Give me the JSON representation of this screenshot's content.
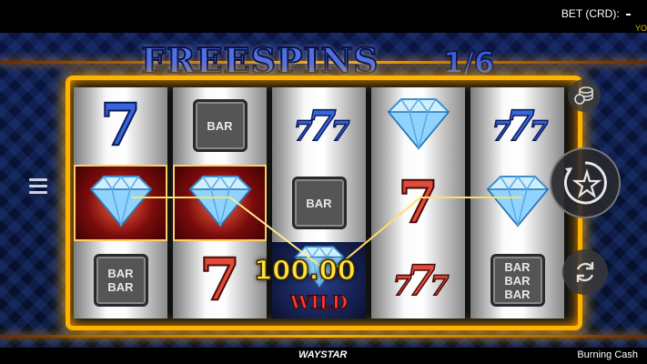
{
  "header": {
    "bet_label": "BET (CRD):",
    "bet_value": "",
    "your_label": "YO"
  },
  "banner": {
    "title": "FREESPINS",
    "counter": "1/6"
  },
  "reels": [
    [
      {
        "sym": "seven-blue"
      },
      {
        "sym": "diamond",
        "highlight": true
      },
      {
        "sym": "bar-double",
        "lines": [
          "BAR",
          "BAR"
        ]
      }
    ],
    [
      {
        "sym": "bar-single",
        "lines": [
          "BAR"
        ]
      },
      {
        "sym": "diamond",
        "highlight": true
      },
      {
        "sym": "seven-red"
      }
    ],
    [
      {
        "sym": "triple-seven-blue"
      },
      {
        "sym": "bar-single",
        "lines": [
          "BAR"
        ]
      },
      {
        "sym": "wild",
        "label": "WILD"
      }
    ],
    [
      {
        "sym": "diamond"
      },
      {
        "sym": "seven-red"
      },
      {
        "sym": "triple-seven-red"
      }
    ],
    [
      {
        "sym": "triple-seven-blue"
      },
      {
        "sym": "diamond"
      },
      {
        "sym": "bar-triple",
        "lines": [
          "BAR",
          "BAR",
          "BAR"
        ]
      }
    ]
  ],
  "win_amount": "100.00",
  "controls": {
    "menu_icon": "hamburger-menu-icon",
    "coins_icon": "coins-stack-icon",
    "spin_icon": "spin-star-icon",
    "autoplay_icon": "autoplay-icon"
  },
  "footer": {
    "brand": "WAYSTAR",
    "game_name": "Burning Cash"
  },
  "colors": {
    "frame": "#ffb300",
    "win_text": "#ffe23a",
    "title": "#4f6fe6",
    "seven_blue": "#3766d8",
    "seven_red": "#e24a3a"
  }
}
